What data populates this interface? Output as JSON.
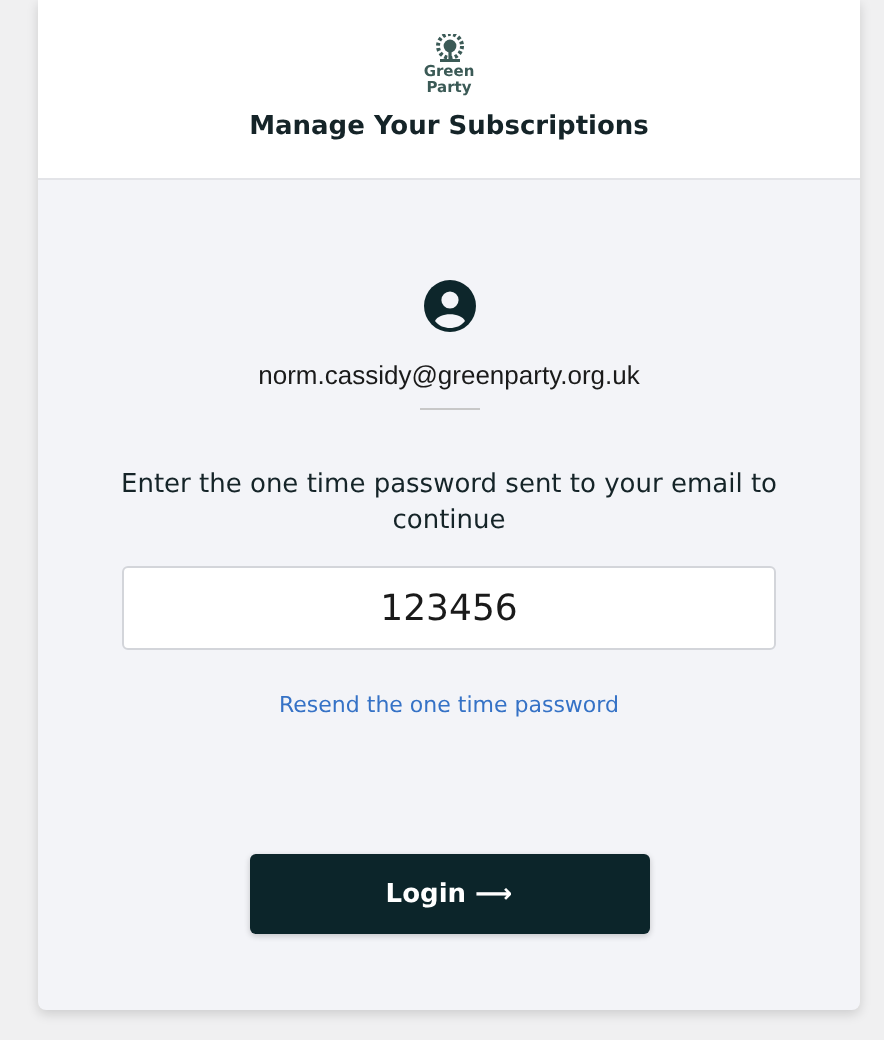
{
  "header": {
    "logo_lines": [
      "Green",
      "Party"
    ],
    "title": "Manage Your Subscriptions"
  },
  "account": {
    "email": "norm.cassidy@greenparty.org.uk"
  },
  "prompt": "Enter the one time password sent to your email to continue",
  "otp_field": {
    "value": "123456"
  },
  "resend_link": "Resend the one time password",
  "login_button": "Login ⟶"
}
